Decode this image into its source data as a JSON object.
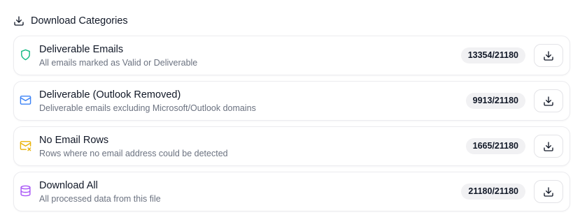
{
  "header": {
    "title": "Download Categories",
    "icon": "download-icon"
  },
  "colors": {
    "deliverable_icon": "#10b981",
    "outlook_icon": "#3b82f6",
    "no_email_icon": "#eab308",
    "all_icon": "#a855f7",
    "badge_bg": "#f1f1f3",
    "card_border": "#ececef"
  },
  "categories": [
    {
      "title": "Deliverable Emails",
      "description": "All emails marked as Valid or Deliverable",
      "count": "13354/21180",
      "icon": "shield-icon",
      "button_icon": "download-icon"
    },
    {
      "title": "Deliverable (Outlook Removed)",
      "description": "Deliverable emails excluding Microsoft/Outlook domains",
      "count": "9913/21180",
      "icon": "mail-icon",
      "button_icon": "download-icon"
    },
    {
      "title": "No Email Rows",
      "description": "Rows where no email address could be detected",
      "count": "1665/21180",
      "icon": "mail-x-icon",
      "button_icon": "download-icon"
    },
    {
      "title": "Download All",
      "description": "All processed data from this file",
      "count": "21180/21180",
      "icon": "database-icon",
      "button_icon": "download-icon"
    }
  ]
}
